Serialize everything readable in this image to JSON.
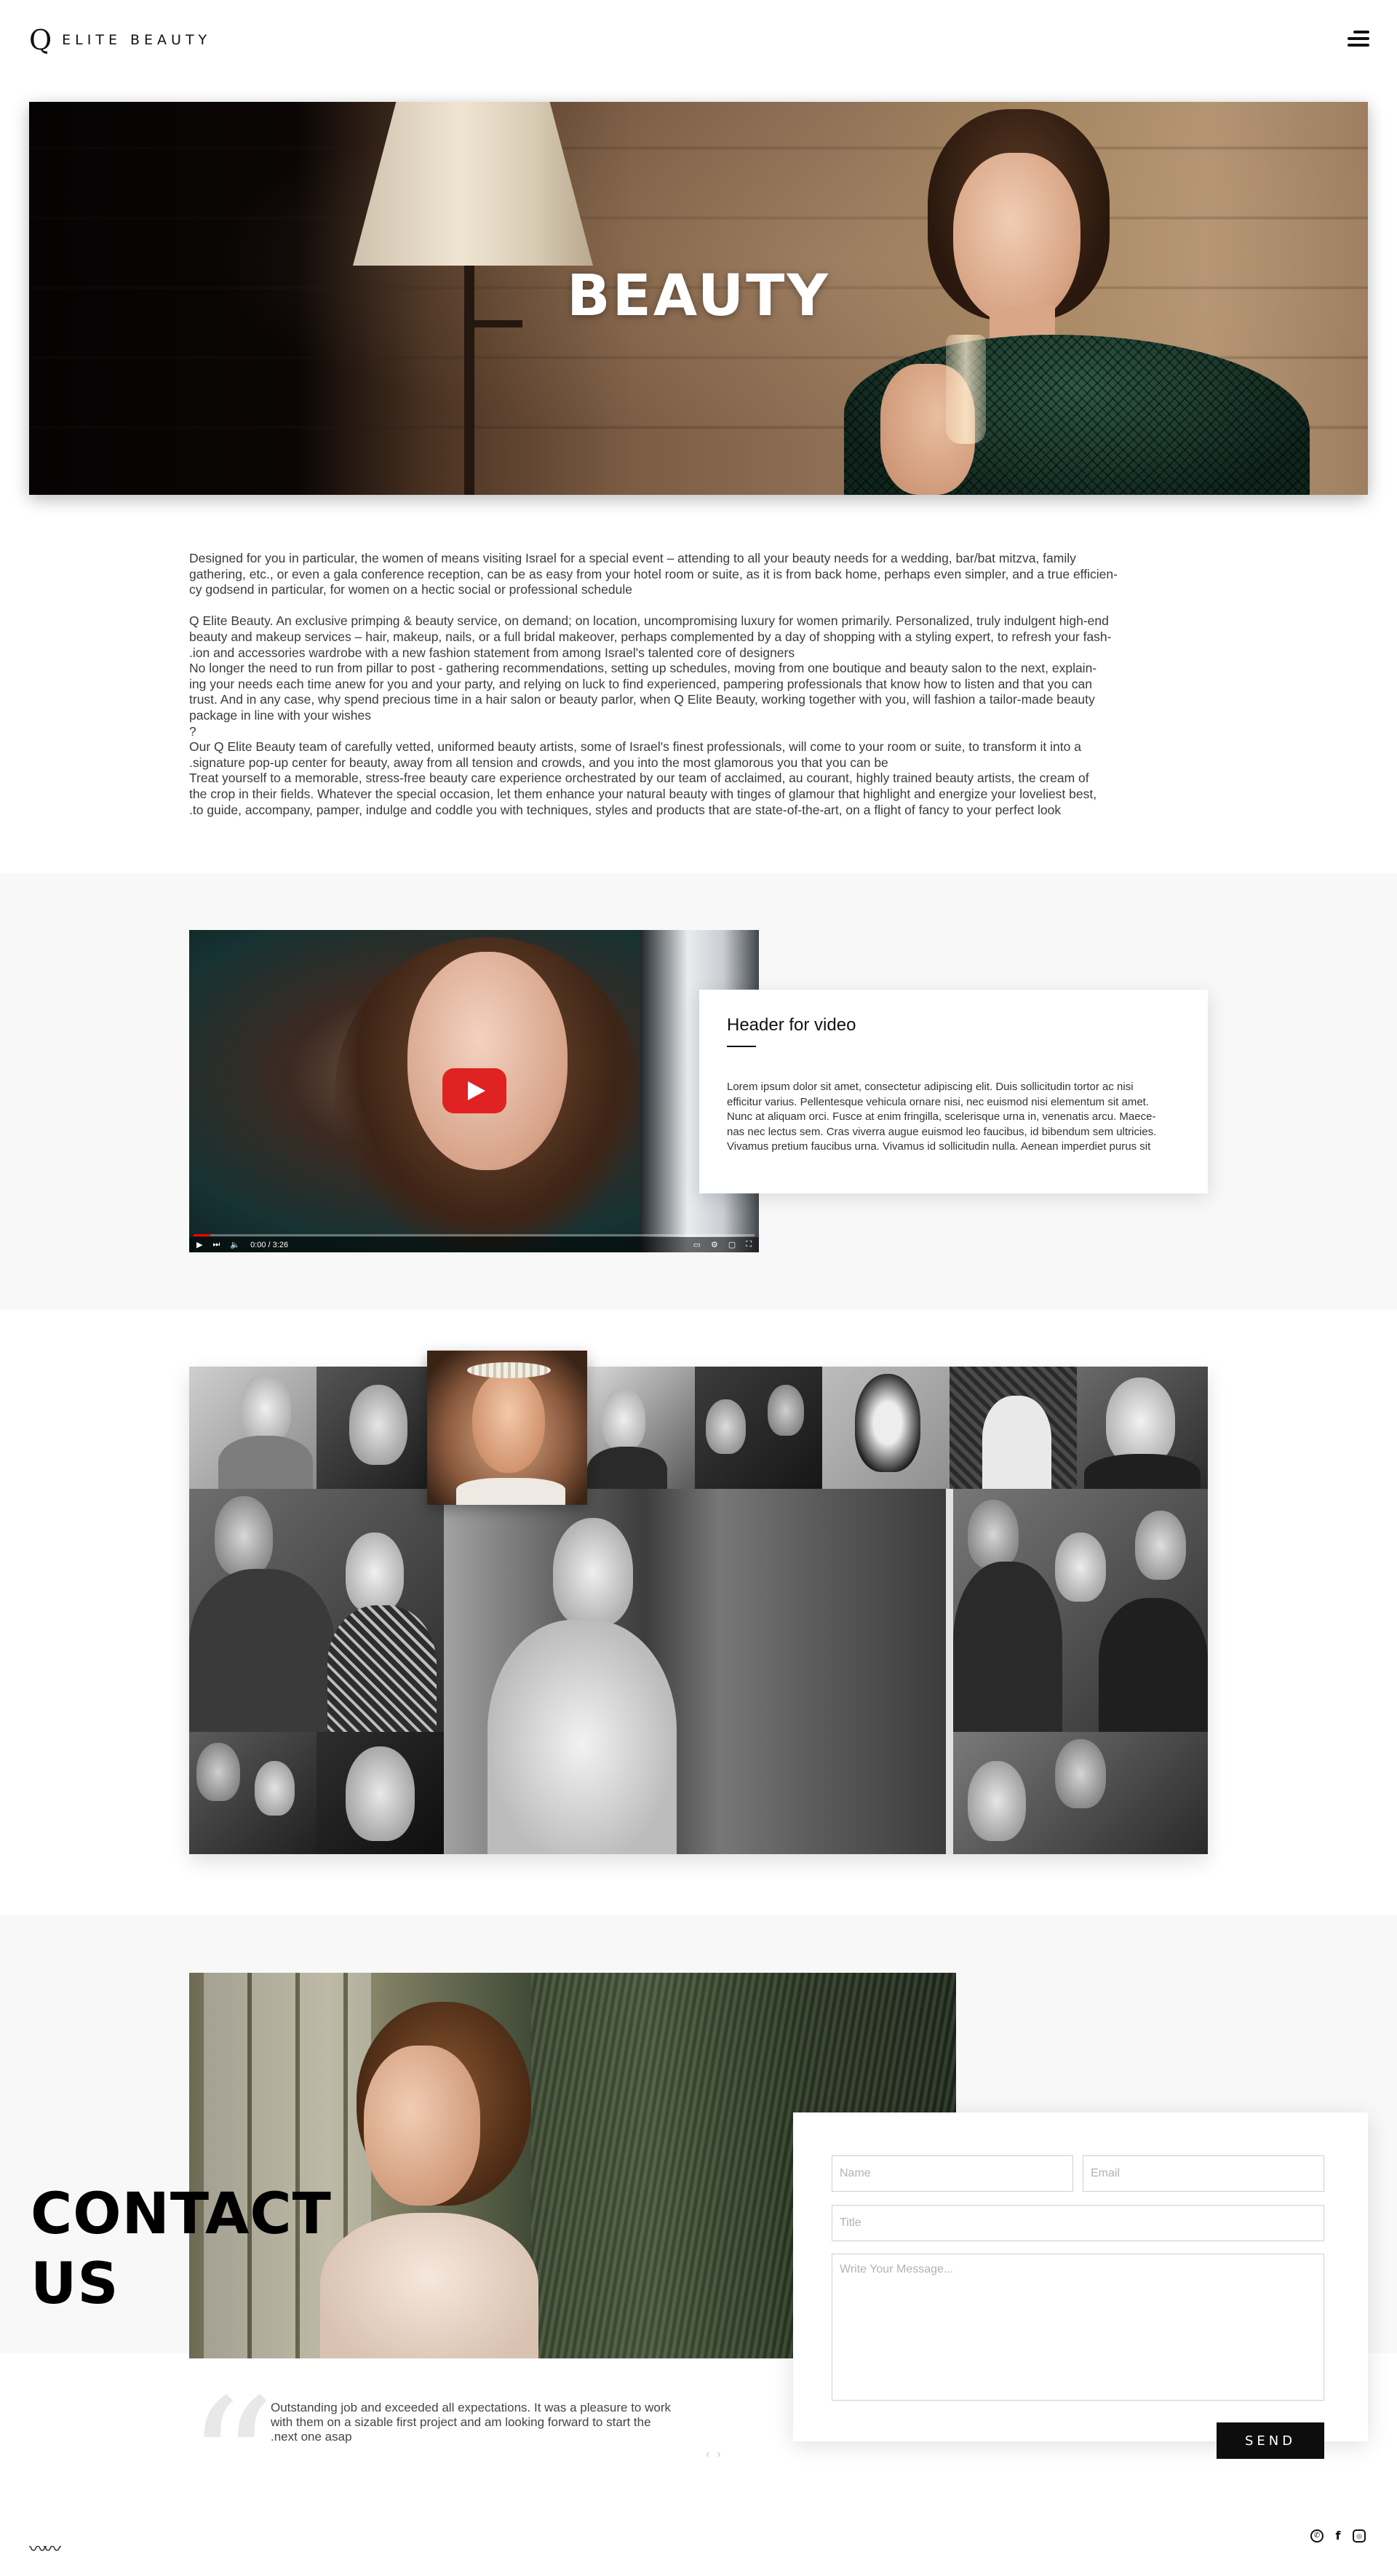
{
  "header": {
    "logo_mark": "Q",
    "logo_text": "ELITE BEAUTY",
    "menu_icon": "hamburger-menu-icon"
  },
  "hero": {
    "title": "BEAUTY"
  },
  "intro": {
    "paragraphs": [
      "Designed for you in particular, the women of means visiting Israel for a special event – attending to all your beauty needs for a wedding, bar/bat mitzva, family",
      "gathering, etc., or even a gala conference reception, can be as easy from your hotel room or suite, as it is from back home, perhaps even simpler, and a true efficien-",
      "cy godsend in particular, for women on a hectic social or professional schedule",
      "",
      "Q Elite Beauty. An exclusive primping & beauty service, on demand; on location, uncompromising luxury for women primarily. Personalized, truly indulgent high-end",
      "beauty and makeup services – hair, makeup, nails, or a full bridal makeover, perhaps complemented by a day of shopping with a styling expert, to refresh your fash-",
      ".ion and accessories wardrobe with a new fashion statement from among Israel's talented core of designers",
      "No longer the need to run from pillar to post - gathering recommendations, setting up schedules, moving from one boutique and beauty salon to the next, explain-",
      "ing your needs each time anew for you and your party, and relying on luck to find experienced, pampering professionals that know how to listen and that you can",
      "trust. And in any case, why spend precious time in a hair salon or beauty parlor, when Q Elite Beauty, working together with you, will fashion a tailor-made beauty",
      "package in line with your wishes",
      "?",
      "Our Q Elite Beauty team of carefully vetted, uniformed beauty artists, some of Israel's finest professionals, will come to your room or suite, to transform it into a",
      ".signature pop-up center for beauty, away from all tension and crowds, and you into the most glamorous  you that you can be",
      "Treat yourself to a memorable, stress-free beauty care experience orchestrated by our team of acclaimed, au courant, highly trained beauty artists, the cream of",
      "the crop in their fields. Whatever the special occasion, let them enhance your natural beauty with tinges of glamour that highlight and energize your loveliest best,",
      ".to guide, accompany, pamper, indulge and coddle you with techniques, styles and products that are state-of-the-art, on a flight of fancy to your perfect look"
    ]
  },
  "video": {
    "play_icon": "youtube-play-icon",
    "time": "0:00 / 3:26",
    "progress": 0.03,
    "card_title": "Header for video",
    "card_body": [
      "Lorem ipsum dolor sit amet, consectetur adipiscing elit. Duis sollicitudin tortor ac nisi",
      "efficitur varius. Pellentesque vehicula ornare nisi, nec euismod nisi elementum sit amet.",
      "Nunc at aliquam orci. Fusce at enim fringilla, scelerisque urna in, venenatis arcu. Maece-",
      "nas nec lectus sem. Cras viverra augue euismod leo faucibus, id bibendum sem ultricies.",
      "Vivamus pretium faucibus urna. Vivamus id sollicitudin nulla. Aenean imperdiet purus sit"
    ]
  },
  "contact": {
    "title_line1": "CONTACT",
    "title_line2": "US",
    "name_placeholder": "Name",
    "email_placeholder": "Email",
    "title_placeholder": "Title",
    "message_placeholder": "Write Your Message...",
    "send_label": "SEND"
  },
  "testimonial": {
    "quote_mark": "“",
    "lines": [
      "Outstanding job and exceeded all expectations. It was a pleasure to work",
      "with them on a sizable first project and am looking forward to start the",
      ".next one asap"
    ],
    "prev": "‹",
    "next": "›"
  },
  "footer": {
    "wave": "〰〰",
    "whatsapp_icon": "✆",
    "facebook_icon": "f",
    "instagram_icon": "◎"
  },
  "colors": {
    "background": "#ffffff",
    "band": "#f8f8f8",
    "accent_dark": "#0d0d0d",
    "youtube_red": "#e02222"
  }
}
